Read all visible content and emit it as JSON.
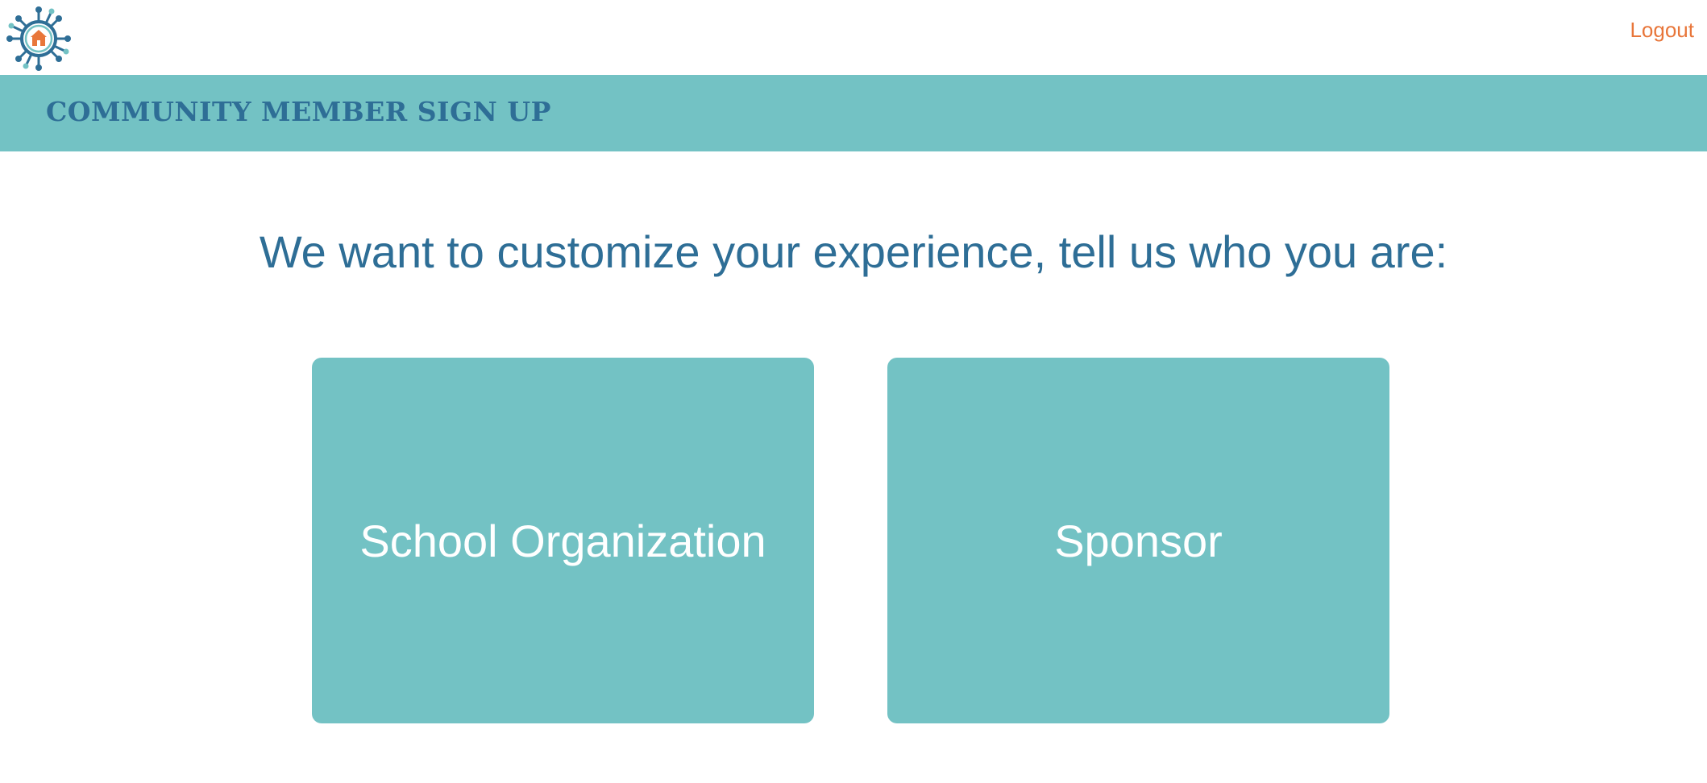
{
  "header": {
    "logout_label": "Logout",
    "logo_icon": "community-virus-house-logo-icon"
  },
  "banner": {
    "title": "COMMUNITY MEMBER SIGN UP"
  },
  "main": {
    "prompt": "We want to customize your experience, tell us who you are:",
    "options": [
      {
        "label": "School Organization"
      },
      {
        "label": "Sponsor"
      }
    ]
  },
  "colors": {
    "accent_teal": "#73c2c4",
    "title_blue": "#2e6e96",
    "logout_orange": "#e8763a",
    "logo_house_orange": "#e8763a"
  }
}
